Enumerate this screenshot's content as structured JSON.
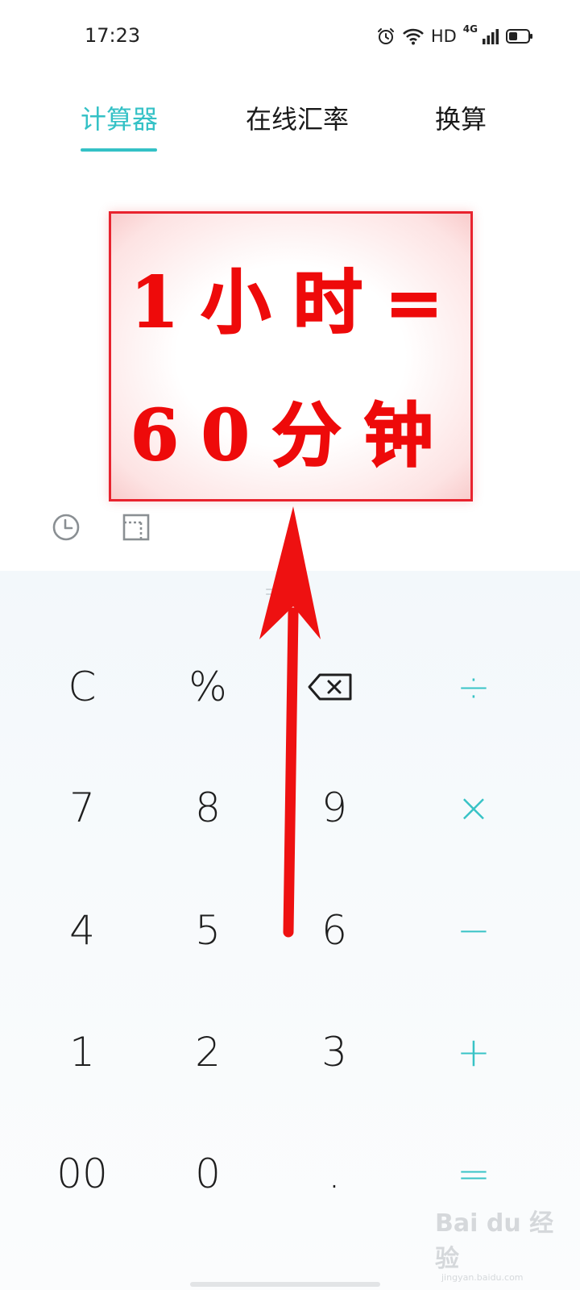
{
  "status_bar": {
    "time": "17:23",
    "icons": [
      "alarm-icon",
      "wifi-icon",
      "signal-icon",
      "battery-icon"
    ],
    "hd_label": "HD",
    "network_label": "4G"
  },
  "tabs": [
    {
      "label": "计算器",
      "active": true
    },
    {
      "label": "在线汇率",
      "active": false
    },
    {
      "label": "换算",
      "active": false
    }
  ],
  "annotation": {
    "line1": "1小时=",
    "line2": "60分钟"
  },
  "tools": {
    "history_icon": "clock-icon",
    "toggle_icon": "scientific-toggle-icon"
  },
  "keypad": {
    "rows": [
      [
        "C",
        "%",
        "⌫",
        "÷"
      ],
      [
        "7",
        "8",
        "9",
        "×"
      ],
      [
        "4",
        "5",
        "6",
        "−"
      ],
      [
        "1",
        "2",
        "3",
        "+"
      ],
      [
        "00",
        "0",
        ".",
        "="
      ]
    ]
  },
  "watermark": {
    "main": "Bai du 经验",
    "sub": "jingyan.baidu.com"
  },
  "colors": {
    "accent": "#34c1c6",
    "annotation_red": "#ee0a0a",
    "keypad_bg": "#f3f8fb"
  }
}
